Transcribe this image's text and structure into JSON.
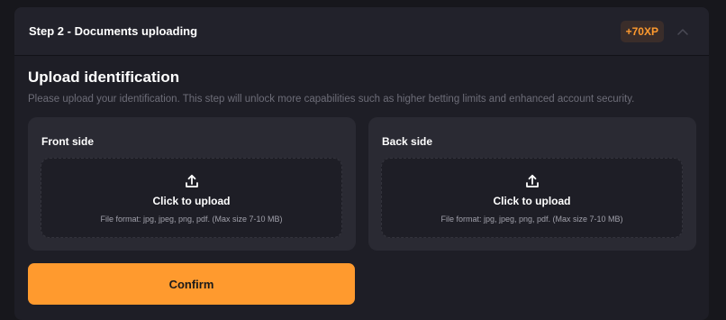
{
  "header": {
    "step_title": "Step 2 - Documents uploading",
    "xp_badge": "+70XP",
    "collapse_icon": "chevron-up-icon"
  },
  "upload": {
    "title": "Upload identification",
    "description": "Please upload your identification. This step will unlock more capabilities such as higher betting limits and enhanced account security."
  },
  "cards": [
    {
      "label": "Front side",
      "icon": "upload-icon",
      "action": "Click to upload",
      "format": "File format: jpg, jpeg, png, pdf. (Max size 7-10 MB)"
    },
    {
      "label": "Back side",
      "icon": "upload-icon",
      "action": "Click to upload",
      "format": "File format: jpg, jpeg, png, pdf. (Max size 7-10 MB)"
    }
  ],
  "confirm_label": "Confirm",
  "colors": {
    "accent": "#ff9a2e",
    "background": "#17171c",
    "panel": "#1e1e26",
    "card": "#2a2a33",
    "muted_text": "#6d6d78"
  }
}
